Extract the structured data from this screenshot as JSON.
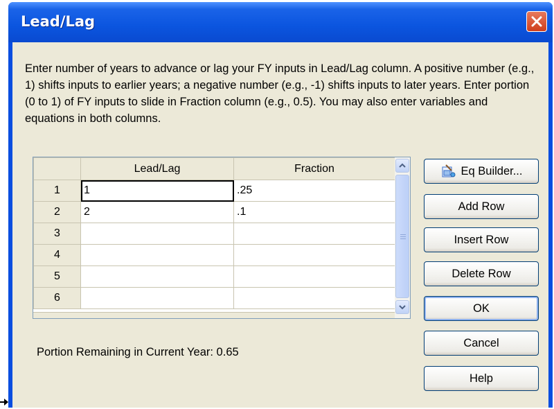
{
  "dialog": {
    "title": "Lead/Lag",
    "description": "Enter number of years to advance or lag your FY inputs in Lead/Lag column. A positive number (e.g., 1) shifts inputs to earlier years; a negative number (e.g., -1) shifts inputs to later years. Enter portion (0 to 1) of FY inputs to slide in Fraction column (e.g., 0.5). You may also enter variables and equations in both columns.",
    "close_icon": "close-icon"
  },
  "grid": {
    "columns": [
      "Lead/Lag",
      "Fraction"
    ],
    "rows": [
      {
        "num": "1",
        "leadlag": "1",
        "fraction": ".25"
      },
      {
        "num": "2",
        "leadlag": "2",
        "fraction": ".1"
      },
      {
        "num": "3",
        "leadlag": "",
        "fraction": ""
      },
      {
        "num": "4",
        "leadlag": "",
        "fraction": ""
      },
      {
        "num": "5",
        "leadlag": "",
        "fraction": ""
      },
      {
        "num": "6",
        "leadlag": "",
        "fraction": ""
      }
    ]
  },
  "buttons": {
    "eq_builder": "Eq Builder...",
    "add_row": "Add Row",
    "insert_row": "Insert Row",
    "delete_row": "Delete Row",
    "ok": "OK",
    "cancel": "Cancel",
    "help": "Help"
  },
  "portion": {
    "text": "Portion Remaining in Current Year:  0.65"
  },
  "colors": {
    "title_bar": "#0a4ee0",
    "client_bg": "#ece9d8",
    "close_button": "#cf3e1c"
  }
}
